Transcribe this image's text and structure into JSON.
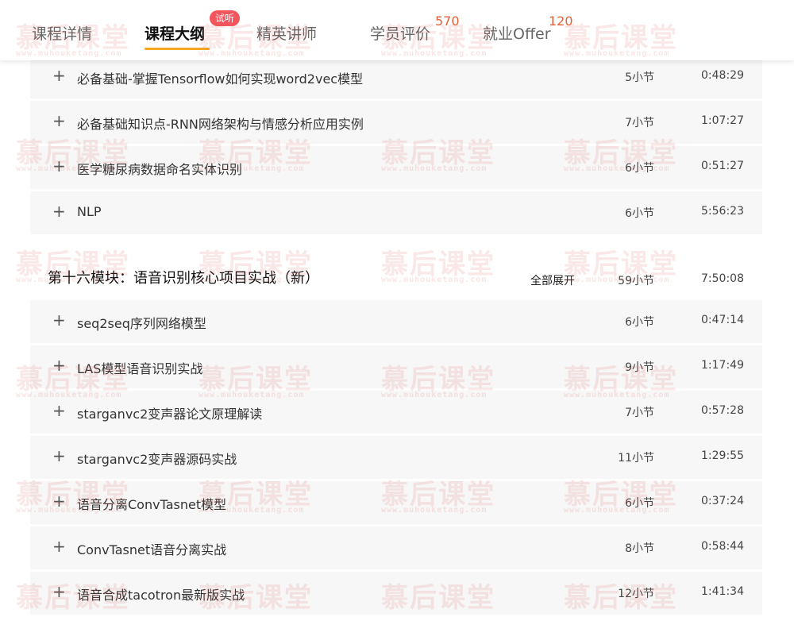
{
  "tabs": [
    {
      "label": "课程详情"
    },
    {
      "label": "课程大纲"
    },
    {
      "label": "精英讲师"
    },
    {
      "label": "学员评价"
    },
    {
      "label": "就业Offer"
    }
  ],
  "trial_badge": "试听",
  "review_count": "570",
  "offer_count": "120",
  "rows_top": [
    {
      "title": "必备基础-掌握Tensorflow如何实现word2vec模型",
      "sections": "5小节",
      "duration": "0:48:29"
    },
    {
      "title": "必备基础知识点-RNN网络架构与情感分析应用实例",
      "sections": "7小节",
      "duration": "1:07:27"
    },
    {
      "title": "医学糖尿病数据命名实体识别",
      "sections": "6小节",
      "duration": "0:51:27"
    },
    {
      "title": "NLP",
      "sections": "6小节",
      "duration": "5:56:23"
    }
  ],
  "module": {
    "title": "第十六模块：语音识别核心项目实战（新）",
    "expand_label": "全部展开",
    "sections": "59小节",
    "duration": "7:50:08"
  },
  "rows_bottom": [
    {
      "title": "seq2seq序列网络模型",
      "sections": "6小节",
      "duration": "0:47:14"
    },
    {
      "title": "LAS模型语音识别实战",
      "sections": "9小节",
      "duration": "1:17:49"
    },
    {
      "title": "starganvc2变声器论文原理解读",
      "sections": "7小节",
      "duration": "0:57:28"
    },
    {
      "title": "starganvc2变声器源码实战",
      "sections": "11小节",
      "duration": "1:29:55"
    },
    {
      "title": "语音分离ConvTasnet模型",
      "sections": "6小节",
      "duration": "0:37:24"
    },
    {
      "title": "ConvTasnet语音分离实战",
      "sections": "8小节",
      "duration": "0:58:44"
    },
    {
      "title": "语音合成tacotron最新版实战",
      "sections": "12小节",
      "duration": "1:41:34"
    }
  ],
  "watermark": {
    "main": "慕后课堂",
    "sub": "www.muhouketang.com"
  },
  "plus_icon": "+"
}
